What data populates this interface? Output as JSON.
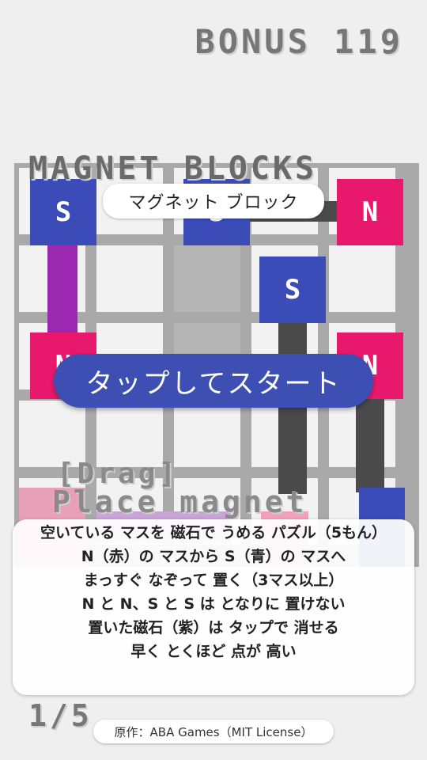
{
  "header": {
    "bonus": "BONUS 119"
  },
  "title": {
    "en": "MAGNET BLOCKS",
    "ja": "マグネット ブロック"
  },
  "start_button": "タップしてスタート",
  "hints": {
    "drag": "[Drag]",
    "place": "Place magnet"
  },
  "rules": [
    "空いている マスを 磁石で うめる パズル（5もん）",
    "N（赤）の マスから S（青）の マスへ",
    "まっすぐ なぞって 置く（3マス以上）",
    "N と N、S と S は となりに 置けない",
    "置いた磁石（紫）は タップで 消せる",
    "早く とくほど 点が 高い"
  ],
  "stage": "1/5",
  "credit": "原作：ABA Games（MIT License）",
  "board": {
    "magnets": [
      {
        "label": "S",
        "pole": "s",
        "col": 0,
        "row": 0
      },
      {
        "label": "S",
        "pole": "s",
        "col": 2,
        "row": 0
      },
      {
        "label": "N",
        "pole": "n",
        "col": 4,
        "row": 0
      },
      {
        "label": "S",
        "pole": "s",
        "col": 3,
        "row": 1
      },
      {
        "label": "N",
        "pole": "n",
        "col": 0,
        "row": 2
      },
      {
        "label": "N",
        "pole": "n",
        "col": 4,
        "row": 2
      }
    ]
  },
  "colors": {
    "north": "#e8196c",
    "south": "#3b4cb8",
    "placed": "#9c27b0",
    "accent": "#3e4fb4"
  }
}
